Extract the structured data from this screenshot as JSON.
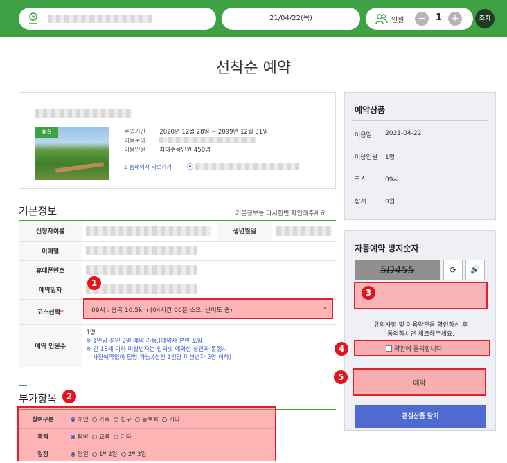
{
  "header": {
    "date": "21/04/22(목)",
    "person_label": "인원",
    "count": "1",
    "minus": "−",
    "plus": "+",
    "search": "조회"
  },
  "page_title": "선착순 예약",
  "product": {
    "badge": "숲길",
    "rows": [
      {
        "label": "운영기간",
        "value": "2020년 12월 28일 ~ 2099년 12월 31일"
      },
      {
        "label": "이용문의",
        "value": ""
      },
      {
        "label": "이용인원",
        "value": "최대수용인원 450명"
      }
    ],
    "homepage": "홈페이지 바로가기"
  },
  "basic": {
    "title": "기본정보",
    "note": "기본정보를 다시한번 확인해주세요.",
    "applicant": "신청자이름",
    "birth": "생년월일",
    "email": "이메일",
    "phone": "휴대폰번호",
    "date": "예약일자",
    "course": "코스선택",
    "course_value": "09시 : 왕복 10.5km (04시간 00분 소요. 난이도 중)",
    "people": "예약 인원수",
    "people_count": "1명",
    "notes": [
      "※ 1인당 성인 2명 예약 가능.(예약자 본인 포함)",
      "※ 만 18세 이하 미성년자는 인터넷 예약한 성인과 동행시",
      "사전예약없이 탐방 가능.(성인 1인당 미성년자 5명 이하)"
    ]
  },
  "extra": {
    "title": "부가항목",
    "rows": [
      {
        "label": "참여구분",
        "options": [
          "개인",
          "가족",
          "친구",
          "동호회",
          "기타"
        ]
      },
      {
        "label": "목적",
        "options": [
          "탐방",
          "교육",
          "기타"
        ]
      },
      {
        "label": "일정",
        "options": [
          "당일",
          "1박2일",
          "2박3일"
        ]
      }
    ]
  },
  "summary": {
    "title": "예약상품",
    "rows": [
      {
        "label": "이용일",
        "value": "2021-04-22"
      },
      {
        "label": "이용인원",
        "value": "1명"
      },
      {
        "label": "코스",
        "value": "09시"
      },
      {
        "label": "합계",
        "value": "0원"
      }
    ]
  },
  "captcha": {
    "title": "자동예약 방지숫자",
    "code": "5D455",
    "notice1": "유의사항 및 이용약관을 확인하신 후",
    "notice2": "동의하시면 체크해주세요.",
    "agree": "약관에 동의합니다.",
    "reserve": "예약",
    "wish": "관심상품 담기"
  },
  "badges": [
    "1",
    "2",
    "3",
    "4",
    "5"
  ],
  "colors": {
    "green": "#3ea244",
    "blue": "#4f6ad0",
    "red": "#e3141b"
  }
}
